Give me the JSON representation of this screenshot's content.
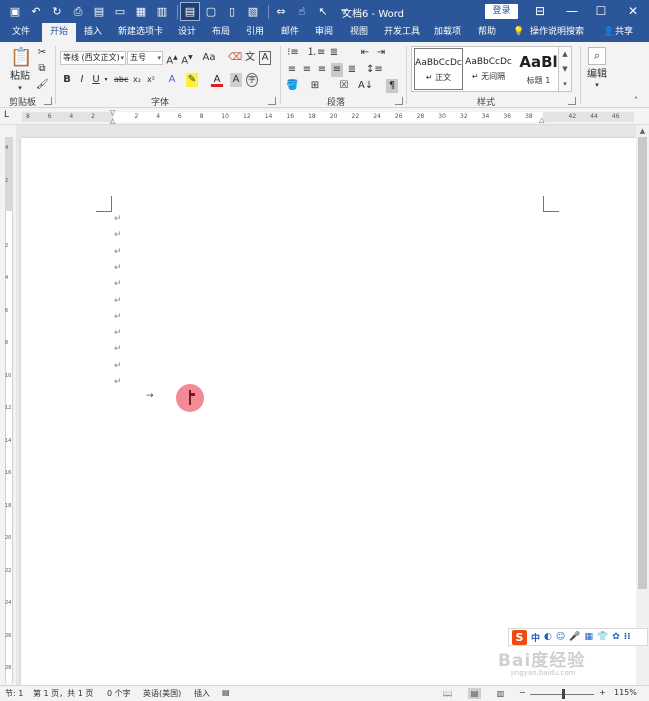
{
  "titlebar": {
    "doc_title": "文档6 - Word",
    "login": "登录",
    "qat": [
      {
        "icon": "save-icon",
        "glyph": "▣"
      },
      {
        "icon": "undo-icon",
        "glyph": "↶"
      },
      {
        "icon": "redo-icon",
        "glyph": "↻"
      },
      {
        "icon": "print-preview-icon",
        "glyph": "⎙"
      },
      {
        "icon": "save-as-icon",
        "glyph": "▤"
      },
      {
        "icon": "open-icon",
        "glyph": "▭"
      },
      {
        "icon": "paste-special-icon",
        "glyph": "▦"
      },
      {
        "icon": "copy-format-icon",
        "glyph": "▥"
      },
      {
        "icon": "page-view-icon",
        "glyph": "▤"
      },
      {
        "icon": "draft-icon",
        "glyph": "▢"
      },
      {
        "icon": "multi-page-icon",
        "glyph": "▯"
      },
      {
        "icon": "page-layout-icon",
        "glyph": "▧"
      },
      {
        "icon": "page-width-icon",
        "glyph": "⇔"
      },
      {
        "icon": "touch-mode-icon",
        "glyph": "☝"
      },
      {
        "icon": "select-icon",
        "glyph": "↖"
      },
      {
        "icon": "customize-qat-icon",
        "glyph": "▿"
      }
    ],
    "window_controls": {
      "ribbon_options": "⊟",
      "minimize": "—",
      "restore": "☐",
      "close": "✕"
    }
  },
  "tabs": [
    {
      "label": "文件"
    },
    {
      "label": "开始"
    },
    {
      "label": "插入"
    },
    {
      "label": "新建选项卡"
    },
    {
      "label": "设计"
    },
    {
      "label": "布局"
    },
    {
      "label": "引用"
    },
    {
      "label": "邮件"
    },
    {
      "label": "审阅"
    },
    {
      "label": "视图"
    },
    {
      "label": "开发工具"
    },
    {
      "label": "加载项"
    },
    {
      "label": "帮助"
    },
    {
      "label": "操作说明搜索"
    },
    {
      "label": "共享"
    }
  ],
  "ribbon": {
    "clipboard": {
      "label": "剪贴板",
      "paste": "粘贴"
    },
    "font": {
      "label": "字体",
      "font_name": "等线 (西文正文)",
      "font_size": "五号",
      "change_case": "Aa",
      "phonetic": "A"
    },
    "paragraph": {
      "label": "段落"
    },
    "styles": {
      "label": "样式",
      "items": [
        {
          "sample": "AaBbCcDc",
          "name": "↵ 正文"
        },
        {
          "sample": "AaBbCcDc",
          "name": "↵ 无间隔"
        },
        {
          "sample": "AaBl",
          "name": "标题 1"
        }
      ]
    },
    "editing": {
      "label": "编辑"
    }
  },
  "ruler": {
    "tab_selector": "L",
    "ticks": [
      "8",
      "6",
      "4",
      "2",
      "",
      "2",
      "4",
      "6",
      "8",
      "10",
      "12",
      "14",
      "16",
      "18",
      "20",
      "22",
      "24",
      "26",
      "28",
      "30",
      "32",
      "34",
      "36",
      "38",
      "",
      "42",
      "44",
      "46"
    ],
    "vticks": [
      "4",
      "2",
      "",
      "2",
      "4",
      "6",
      "8",
      "10",
      "12",
      "14",
      "16",
      "18",
      "20",
      "22",
      "24",
      "26",
      "28"
    ]
  },
  "document": {
    "paragraph_mark": "↵",
    "paragraph_count": 11,
    "tab_mark": "→"
  },
  "ime": {
    "items": [
      "中",
      "◐",
      "☺",
      "🎤",
      "▦",
      "👕",
      "✿",
      "⁝⁝"
    ]
  },
  "watermark": {
    "text": "Bai度经验",
    "url": "jingyan.baidu.com"
  },
  "statusbar": {
    "section": "节: 1",
    "page": "第 1 页，共 1 页",
    "words": "0 个字",
    "language": "英语(美国)",
    "mode": "插入",
    "zoom": "115%"
  }
}
